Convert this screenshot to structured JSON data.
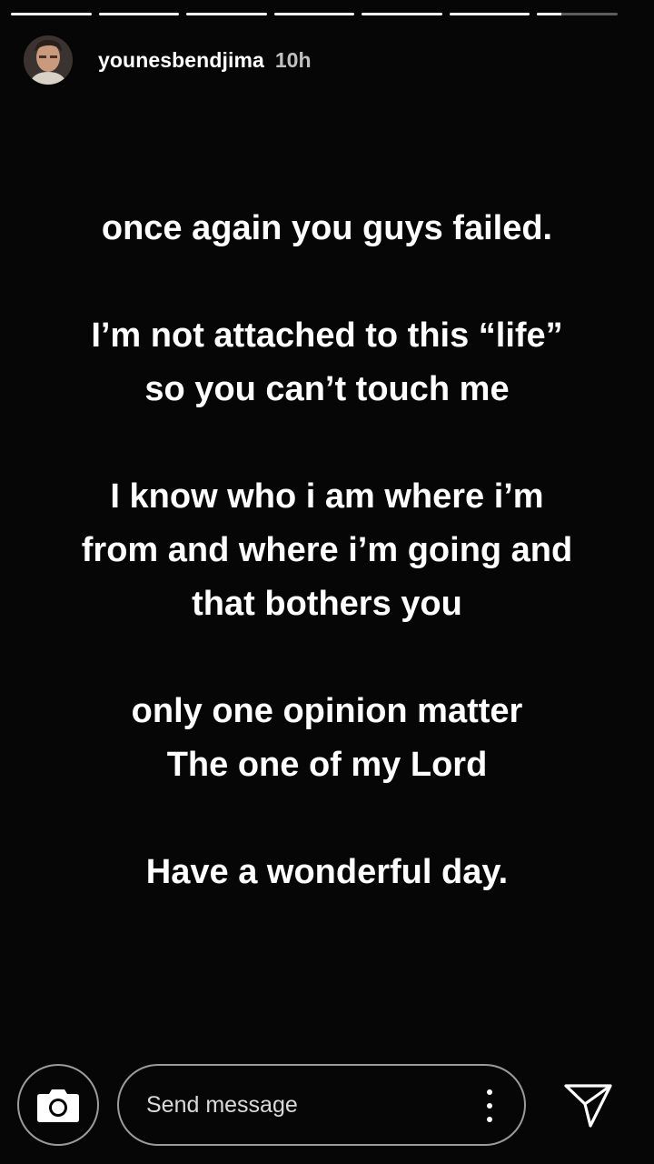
{
  "story": {
    "segments_total": 7,
    "segments_progress": [
      1,
      1,
      1,
      1,
      1,
      1,
      0.3
    ],
    "user": {
      "username": "younesbendjima",
      "time_ago": "10h"
    },
    "paragraphs": [
      {
        "lines": [
          "once again you guys failed."
        ]
      },
      {
        "lines": [
          "I’m not attached to this “life”",
          "so you can’t touch me"
        ]
      },
      {
        "lines": [
          "I know who i am where i’m",
          "from and where i’m going and",
          "that bothers you"
        ]
      },
      {
        "lines": [
          "only one opinion matter",
          "The one of my Lord"
        ]
      },
      {
        "lines": [
          "Have a wonderful day."
        ]
      }
    ]
  },
  "footer": {
    "message_placeholder": "Send message",
    "camera_icon": "camera-icon",
    "more_icon": "more-vertical-icon",
    "send_icon": "send-icon"
  }
}
